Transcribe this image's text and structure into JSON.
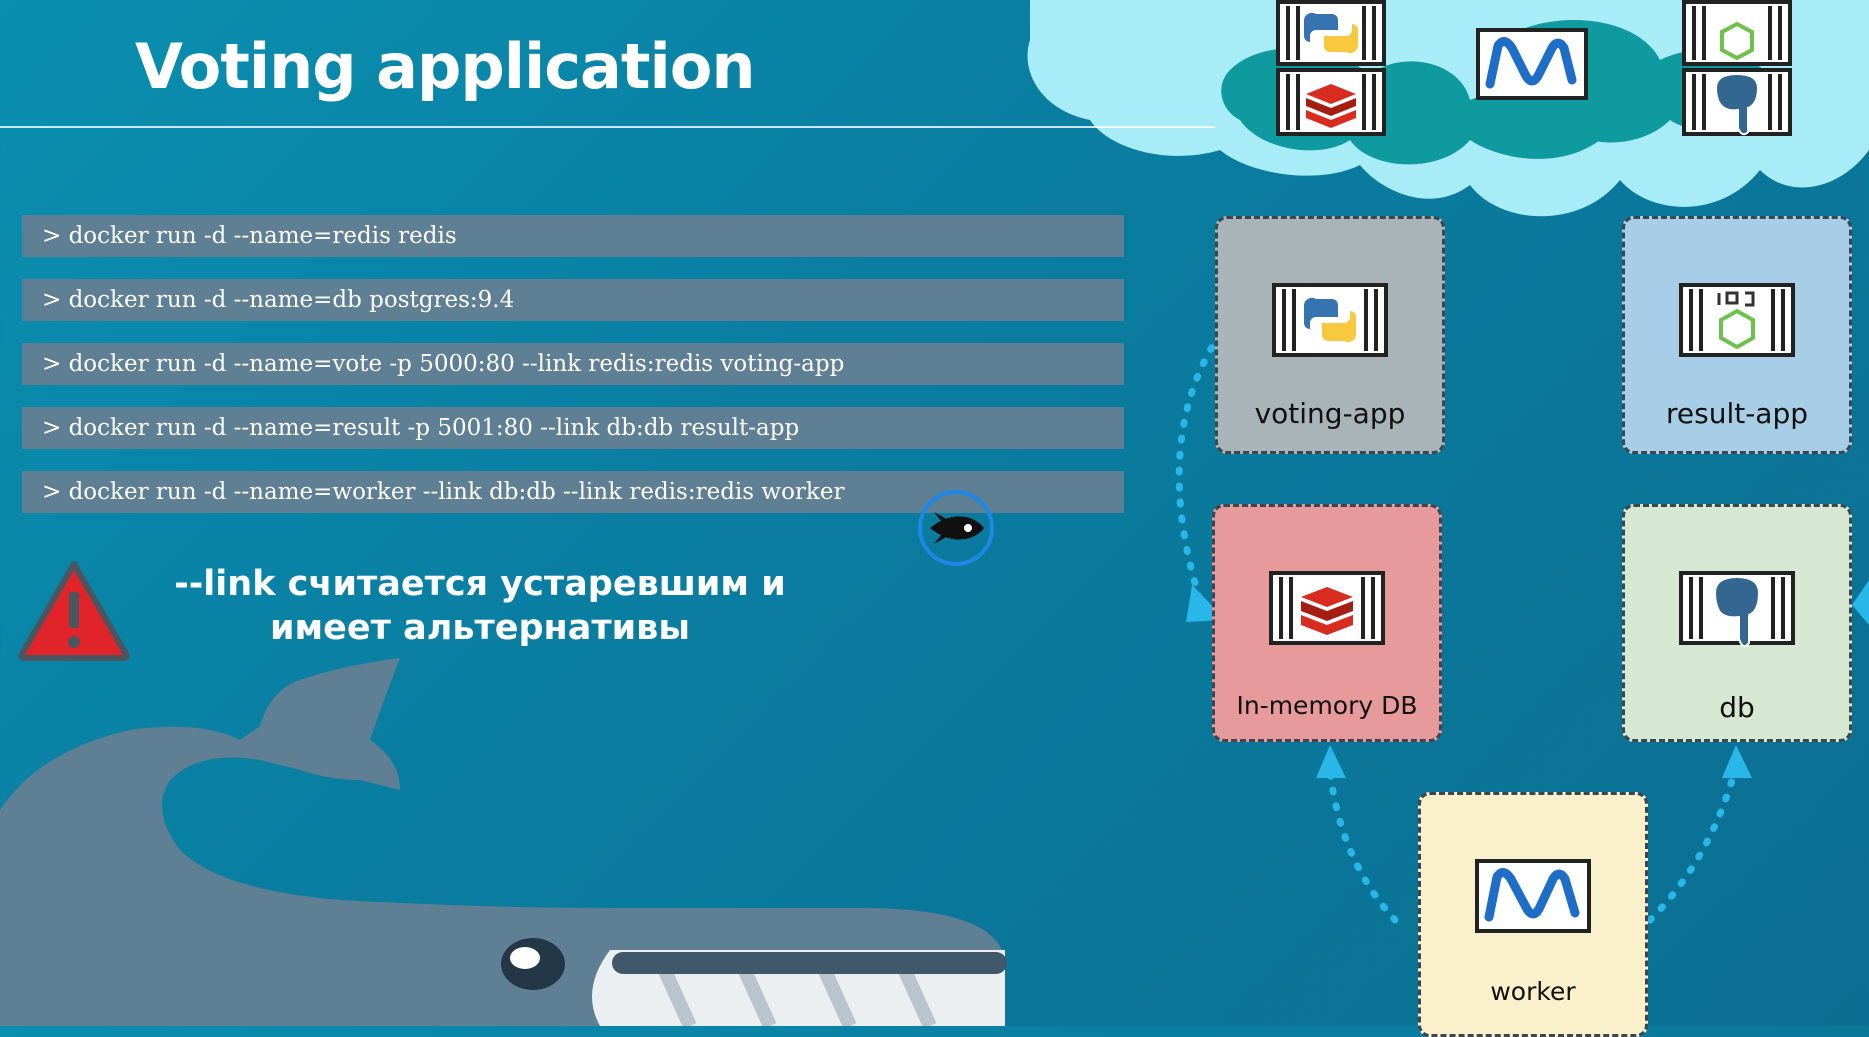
{
  "title": "Voting application",
  "commands": [
    "> docker run -d --name=redis redis",
    "> docker run -d --name=db postgres:9.4",
    "> docker run -d --name=vote -p 5000:80 --link redis:redis voting-app",
    "> docker run -d --name=result -p 5001:80 --link db:db result-app",
    "> docker run -d --name=worker --link db:db --link redis:redis worker"
  ],
  "warning": {
    "line1": "--link считается устаревшим и",
    "line2": "имеет альтернативы"
  },
  "diagram": {
    "nodes": [
      {
        "id": "voting-app",
        "label": "voting-app",
        "icon": "python-container-icon",
        "color": "#a9b4b8"
      },
      {
        "id": "result-app",
        "label": "result-app",
        "icon": "nodejs-container-icon",
        "color": "#a8cde6"
      },
      {
        "id": "in-memory-db",
        "label": "In-memory DB",
        "icon": "redis-container-icon",
        "color": "#e79a9c"
      },
      {
        "id": "db",
        "label": "db",
        "icon": "postgres-container-icon",
        "color": "#d6e7d2"
      },
      {
        "id": "worker",
        "label": "worker",
        "icon": "dotnet-container-icon",
        "color": "#fbf0cc"
      }
    ],
    "edges": [
      {
        "from": "voting-app",
        "to": "in-memory-db"
      },
      {
        "from": "worker",
        "to": "in-memory-db"
      },
      {
        "from": "worker",
        "to": "db"
      },
      {
        "from": "result-app",
        "to": "db"
      }
    ]
  },
  "colors": {
    "background": "#0a86a8",
    "command_bar": "#5e7f94",
    "warning_red": "#e0242a",
    "arrow": "#29b6e8"
  }
}
